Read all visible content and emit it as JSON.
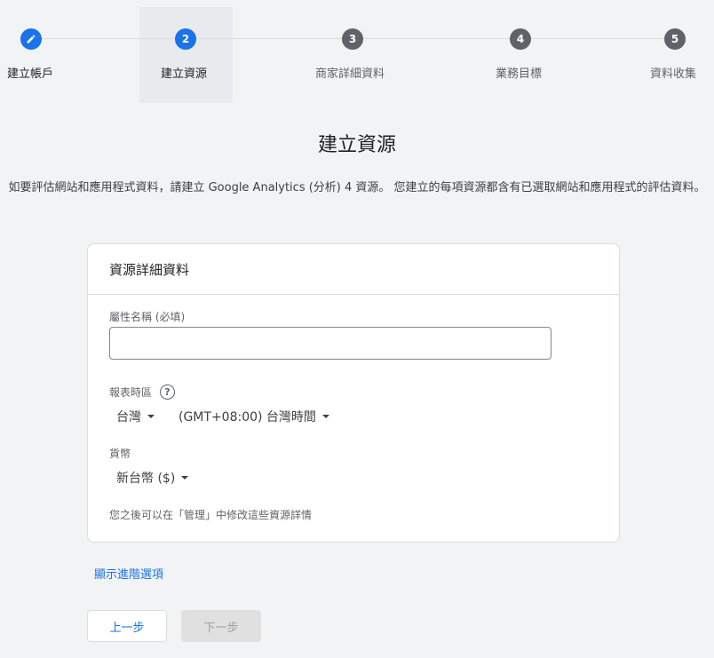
{
  "stepper": {
    "steps": [
      {
        "number": "",
        "label": "建立帳戶",
        "icon": "pencil-icon"
      },
      {
        "number": "2",
        "label": "建立資源"
      },
      {
        "number": "3",
        "label": "商家詳細資料"
      },
      {
        "number": "4",
        "label": "業務目標"
      },
      {
        "number": "5",
        "label": "資料收集"
      }
    ]
  },
  "main": {
    "title": "建立資源",
    "description": "如要評估網站和應用程式資料，請建立 Google Analytics (分析) 4 資源。 您建立的每項資源都含有已選取網站和應用程式的評估資料。"
  },
  "card": {
    "header": "資源詳細資料",
    "property_name_label": "屬性名稱 (必填)",
    "property_name_value": "",
    "timezone_label": "報表時區",
    "help_icon": "?",
    "country_value": "台灣",
    "timezone_value": "(GMT+08:00) 台灣時間",
    "currency_label": "貨幣",
    "currency_value": "新台幣 ($)",
    "note": "您之後可以在「管理」中修改這些資源詳情"
  },
  "advanced_link": "顯示進階選項",
  "buttons": {
    "back": "上一步",
    "next": "下一步"
  },
  "colors": {
    "accent": "#1a73e8",
    "step_inactive": "#5f6368",
    "background": "#f1f3f4"
  }
}
